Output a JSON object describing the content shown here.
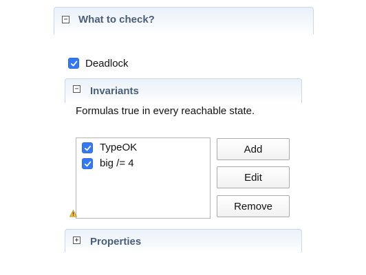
{
  "what_to_check": {
    "title": "What to check?",
    "toggle": "−"
  },
  "deadlock": {
    "label": "Deadlock",
    "checked": true
  },
  "invariants": {
    "title": "Invariants",
    "toggle": "−",
    "description": "Formulas true in every reachable state.",
    "items": [
      {
        "label": "TypeOK",
        "checked": true
      },
      {
        "label": "big /= 4",
        "checked": true
      }
    ],
    "buttons": {
      "add": "Add",
      "edit": "Edit",
      "remove": "Remove"
    }
  },
  "properties": {
    "title": "Properties",
    "toggle": "+"
  },
  "colors": {
    "checkbox_blue": "#3478f6",
    "section_title": "#4a5e78",
    "section_border": "#c9d7e6"
  },
  "icons": {
    "warning": "warning-icon",
    "check": "checkmark-icon"
  }
}
